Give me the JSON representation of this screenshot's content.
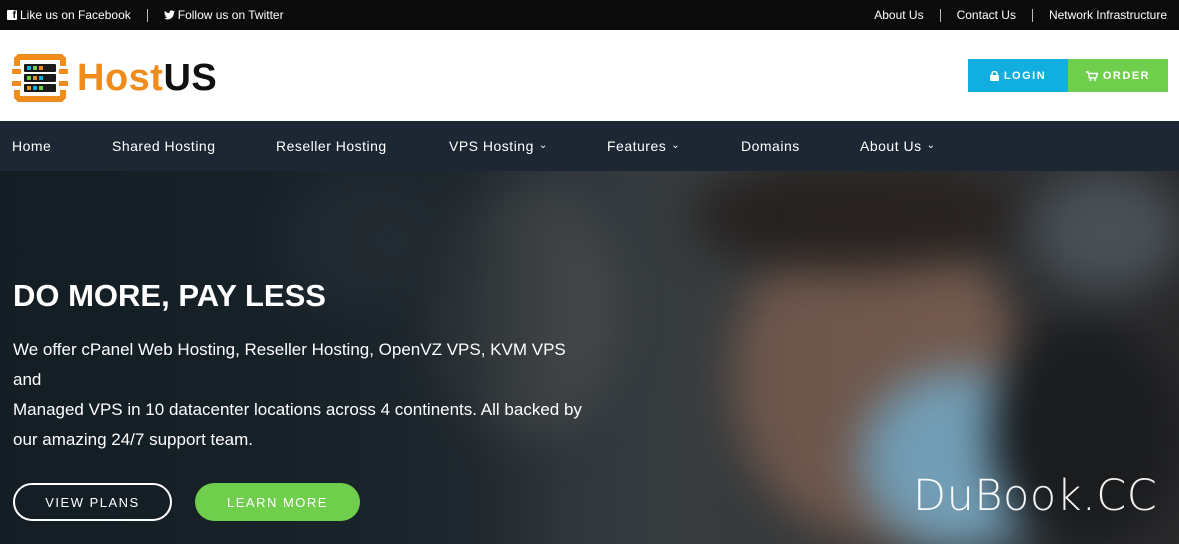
{
  "topbar": {
    "facebook": "Like us on Facebook",
    "twitter": "Follow us on Twitter",
    "links": [
      "About Us",
      "Contact Us",
      "Network Infrastructure"
    ]
  },
  "brand": {
    "part1": "Host",
    "part2": "US",
    "accent": "#f08c1c"
  },
  "header_buttons": {
    "login": "LOGIN",
    "order": "ORDER",
    "login_color": "#11aee0",
    "order_color": "#6fcf4d"
  },
  "nav": [
    {
      "label": "Home",
      "dropdown": false
    },
    {
      "label": "Shared Hosting",
      "dropdown": false
    },
    {
      "label": "Reseller Hosting",
      "dropdown": false
    },
    {
      "label": "VPS Hosting",
      "dropdown": true
    },
    {
      "label": "Features",
      "dropdown": true
    },
    {
      "label": "Domains",
      "dropdown": false
    },
    {
      "label": "About Us",
      "dropdown": true
    }
  ],
  "hero": {
    "title": "DO MORE, PAY LESS",
    "subtitle_lines": [
      "We offer cPanel Web Hosting, Reseller Hosting, OpenVZ VPS, KVM VPS and",
      "Managed VPS in 10 datacenter locations across 4 continents. All backed by",
      "our amazing 24/7 support team."
    ],
    "btn_plans": "VIEW PLANS",
    "btn_learn": "LEARN MORE"
  },
  "watermark": "DuBook.CC"
}
